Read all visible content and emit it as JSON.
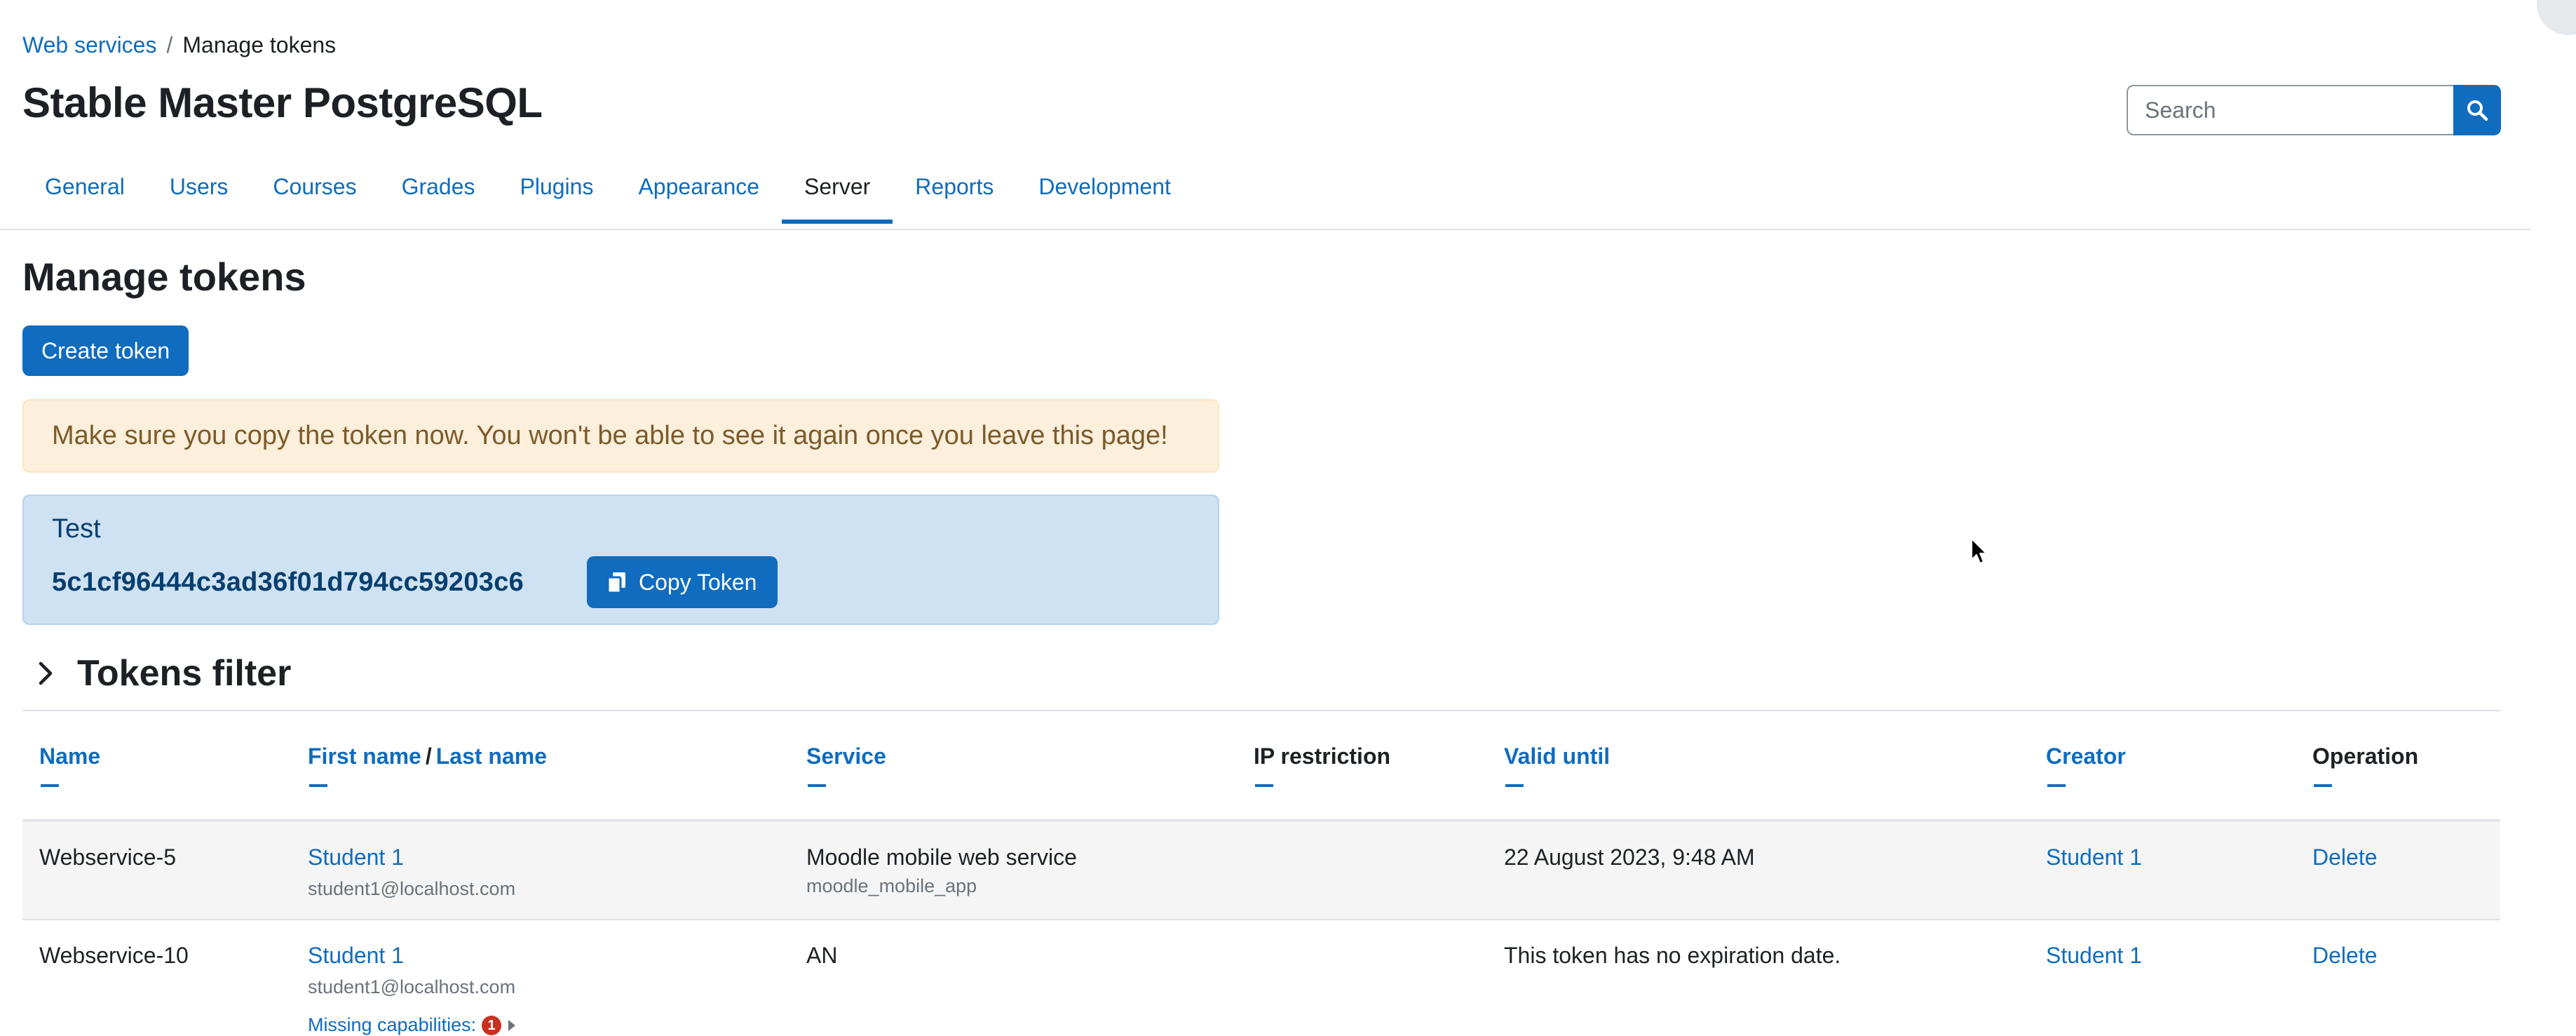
{
  "breadcrumb": {
    "parent": "Web services",
    "separator": "/",
    "current": "Manage tokens"
  },
  "site": {
    "title": "Stable Master PostgreSQL"
  },
  "search": {
    "placeholder": "Search"
  },
  "nav": {
    "items": [
      "General",
      "Users",
      "Courses",
      "Grades",
      "Plugins",
      "Appearance",
      "Server",
      "Reports",
      "Development"
    ],
    "active": "Server"
  },
  "page": {
    "heading": "Manage tokens",
    "create_button": "Create token"
  },
  "warning": {
    "text": "Make sure you copy the token now. You won't be able to see it again once you leave this page!"
  },
  "token_box": {
    "name": "Test",
    "token": "5c1cf96444c3ad36f01d794cc59203c6",
    "copy_label": "Copy Token"
  },
  "filter": {
    "title": "Tokens filter"
  },
  "table": {
    "headers": {
      "name": "Name",
      "first_name": "First name",
      "slash": "/",
      "last_name": "Last name",
      "service": "Service",
      "ip_restriction": "IP restriction",
      "valid_until": "Valid until",
      "creator": "Creator",
      "operation": "Operation"
    },
    "rows": [
      {
        "name": "Webservice-5",
        "user": "Student 1",
        "email": "student1@localhost.com",
        "service": "Moodle mobile web service",
        "service_short": "moodle_mobile_app",
        "ip_restriction": "",
        "valid_until": "22 August 2023, 9:48 AM",
        "creator": "Student 1",
        "operation": "Delete"
      },
      {
        "name": "Webservice-10",
        "user": "Student 1",
        "email": "student1@localhost.com",
        "missing_capabilities": "Missing capabilities:",
        "missing_count": "1",
        "service": "AN",
        "ip_restriction": "",
        "valid_until": "This token has no expiration date.",
        "creator": "Student 1",
        "operation": "Delete"
      }
    ]
  },
  "colors": {
    "primary": "#0f6cbf",
    "warning_bg": "#fcefdc",
    "info_bg": "#cfe2f3",
    "text": "#1d2125"
  },
  "icons": {
    "search": "search-icon",
    "copy": "copy-icon",
    "chevron": "chevron-right-icon",
    "cursor": "mouse-pointer-icon"
  }
}
